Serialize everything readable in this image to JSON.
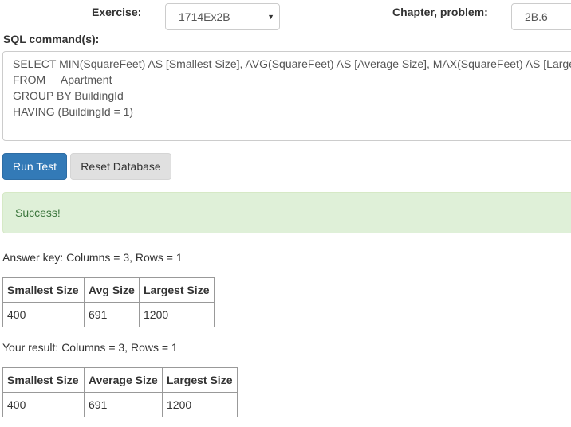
{
  "header": {
    "exercise_label": "Exercise:",
    "exercise_value": "1714Ex2B",
    "chapter_label": "Chapter, problem:",
    "chapter_value": "2B.6"
  },
  "sql": {
    "label": "SQL command(s):",
    "lines": [
      "SELECT MIN(SquareFeet) AS [Smallest Size], AVG(SquareFeet) AS [Average Size], MAX(SquareFeet) AS [Largest Size]",
      "FROM     Apartment",
      "GROUP BY BuildingId",
      "HAVING (BuildingId = 1)"
    ]
  },
  "buttons": {
    "run_label": "Run Test",
    "reset_label": "Reset Database"
  },
  "alert": {
    "message": "Success!"
  },
  "answer_key": {
    "caption": "Answer key: Columns = 3, Rows = 1",
    "headers": [
      "Smallest Size",
      "Avg Size",
      "Largest Size"
    ],
    "rows": [
      [
        "400",
        "691",
        "1200"
      ]
    ]
  },
  "your_result": {
    "caption": "Your result: Columns = 3, Rows = 1",
    "headers": [
      "Smallest Size",
      "Average Size",
      "Largest Size"
    ],
    "rows": [
      [
        "400",
        "691",
        "1200"
      ]
    ]
  },
  "icons": {
    "select_arrow": "chevron-down-icon"
  }
}
